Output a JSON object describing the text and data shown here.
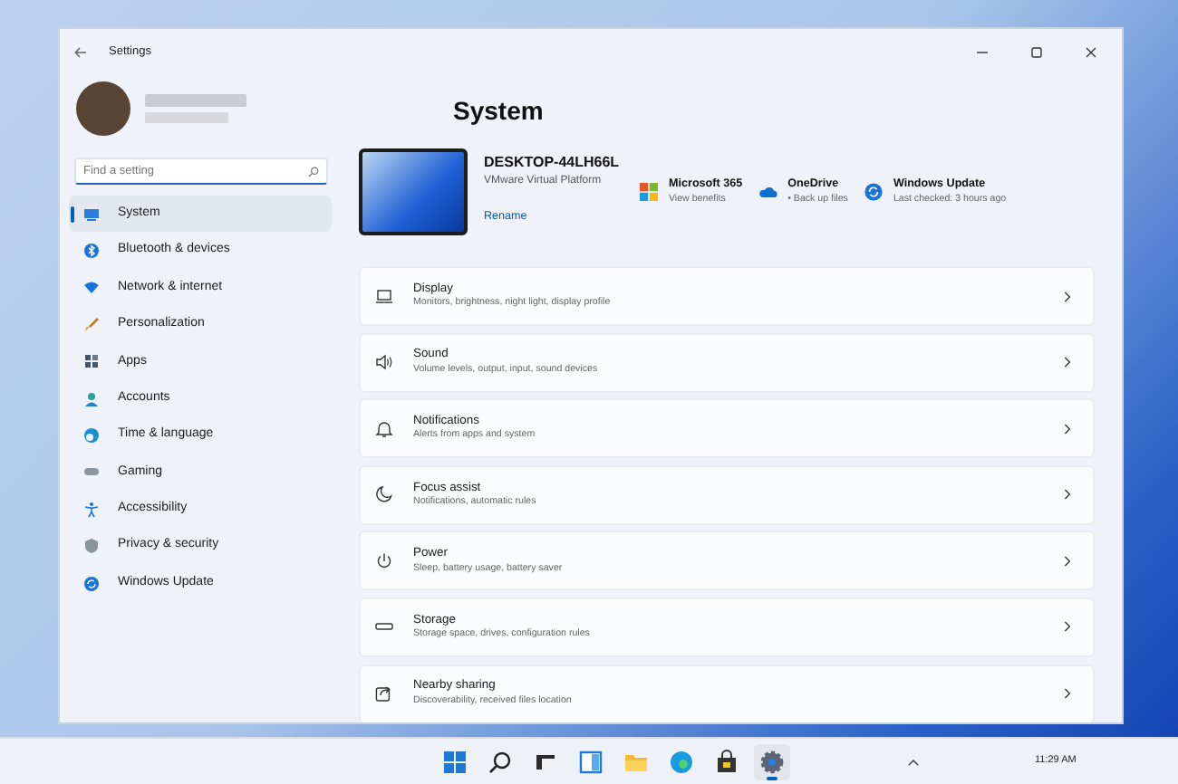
{
  "window": {
    "title": "Settings"
  },
  "search": {
    "placeholder": "Find a setting"
  },
  "sidebar": {
    "items": [
      {
        "label": "System",
        "selected": true
      },
      {
        "label": "Bluetooth & devices",
        "selected": false
      },
      {
        "label": "Network & internet",
        "selected": false
      },
      {
        "label": "Personalization",
        "selected": false
      },
      {
        "label": "Apps",
        "selected": false
      },
      {
        "label": "Accounts",
        "selected": false
      },
      {
        "label": "Time & language",
        "selected": false
      },
      {
        "label": "Gaming",
        "selected": false
      },
      {
        "label": "Accessibility",
        "selected": false
      },
      {
        "label": "Privacy & security",
        "selected": false
      },
      {
        "label": "Windows Update",
        "selected": false
      }
    ]
  },
  "page_title": "System",
  "device": {
    "name": "DESKTOP-44LH66L",
    "model": "VMware Virtual Platform",
    "rename": "Rename"
  },
  "quick_links": [
    {
      "title": "Microsoft 365",
      "subtitle": "View benefits"
    },
    {
      "title": "OneDrive",
      "subtitle": "• Back up files"
    },
    {
      "title": "Windows Update",
      "subtitle": "Last checked: 3 hours ago"
    }
  ],
  "settings": [
    {
      "title": "Display",
      "subtitle": "Monitors, brightness, night light, display profile"
    },
    {
      "title": "Sound",
      "subtitle": "Volume levels, output, input, sound devices"
    },
    {
      "title": "Notifications",
      "subtitle": "Alerts from apps and system"
    },
    {
      "title": "Focus assist",
      "subtitle": "Notifications, automatic rules"
    },
    {
      "title": "Power",
      "subtitle": "Sleep, battery usage, battery saver"
    },
    {
      "title": "Storage",
      "subtitle": "Storage space, drives, configuration rules"
    },
    {
      "title": "Nearby sharing",
      "subtitle": "Discoverability, received files location"
    }
  ],
  "taskbar": {
    "apps": [
      {
        "running": false
      },
      {
        "running": false
      },
      {
        "running": false
      },
      {
        "running": false
      },
      {
        "running": false
      },
      {
        "running": false
      },
      {
        "running": false
      },
      {
        "running": true
      }
    ],
    "time": "11:29 AM"
  }
}
